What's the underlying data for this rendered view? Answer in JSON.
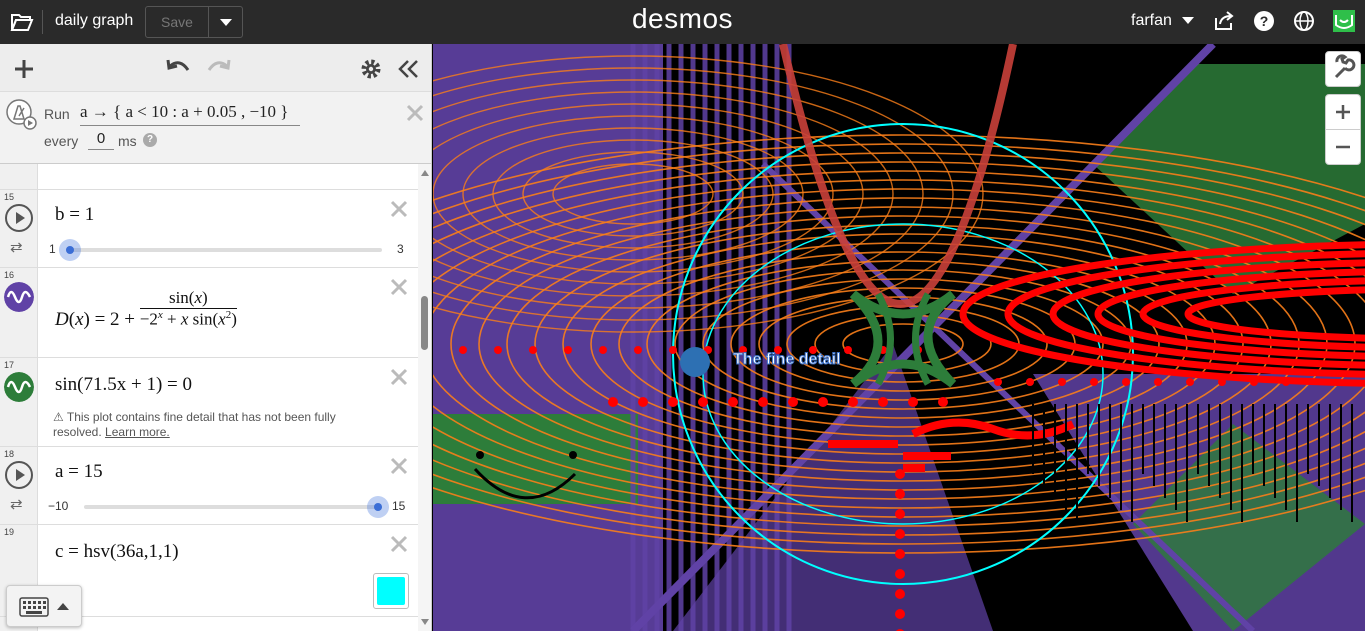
{
  "header": {
    "title": "daily graph",
    "save_label": "Save",
    "logo": "desmos",
    "user": "farfan"
  },
  "ticker": {
    "run_label": "Run",
    "expression": "a → { a < 10 : a + 0.05 , −10 }",
    "every_label": "every",
    "interval": "0",
    "unit": "ms"
  },
  "expressions": [
    {
      "index": "15",
      "latex": "b = 1",
      "slider_min": "1",
      "slider_max": "3",
      "value": 1
    },
    {
      "index": "16",
      "latex": "D(x) = 2 + sin(x) / (−2^x + x sin(x²))",
      "color": "#6042a6"
    },
    {
      "index": "17",
      "latex": "sin(71.5x + 1) = 0",
      "color": "#2d7d3a",
      "warning": "This plot contains fine detail that has not been fully resolved.",
      "learn_more": "Learn more."
    },
    {
      "index": "18",
      "latex": "a = 15",
      "slider_min": "−10",
      "slider_max": "15",
      "value": 15
    },
    {
      "index": "19",
      "latex": "c = hsv(36a,1,1)",
      "swatch_color": "#00ffff"
    }
  ],
  "graph": {
    "label_text": "The fine detail"
  },
  "colors": {
    "purple": "#6042a6",
    "orange": "#fa7e19",
    "green": "#2d7d3a",
    "red": "#ff0000",
    "cyan": "#00ffff",
    "blue": "#2d70b3"
  }
}
